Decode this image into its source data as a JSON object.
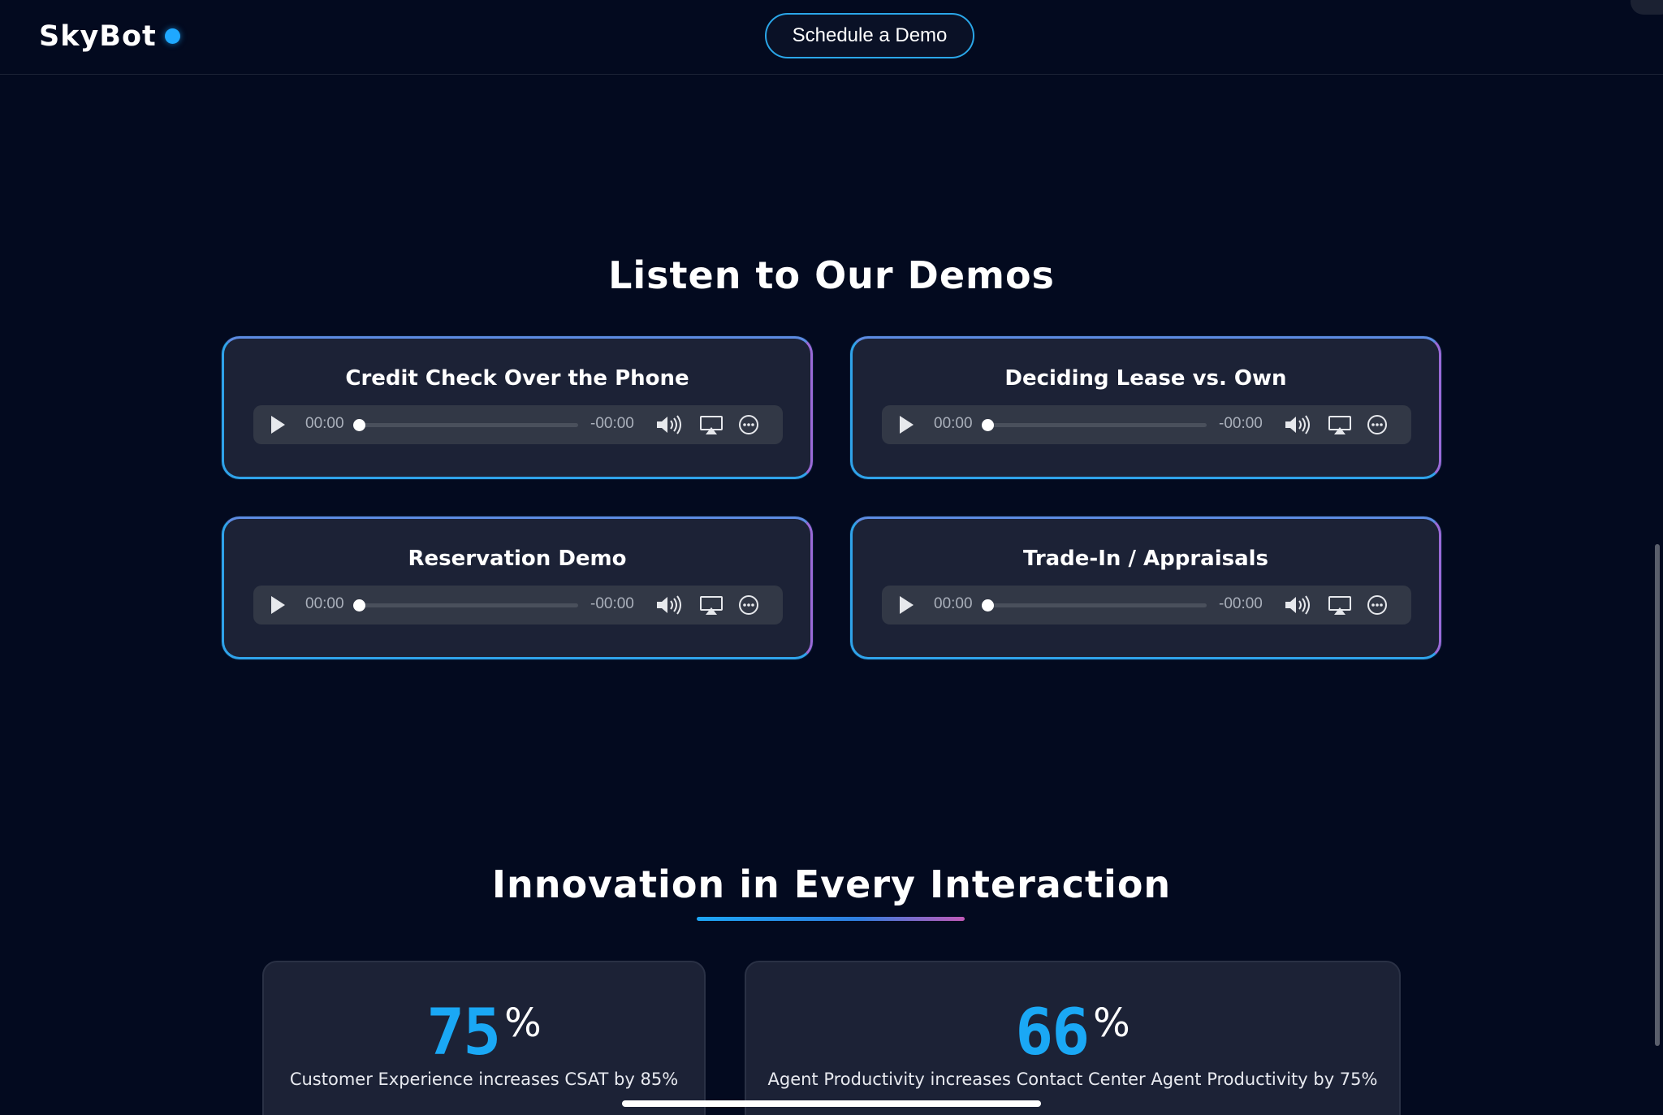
{
  "header": {
    "logo_text": "SkyBot",
    "cta_label": "Schedule a Demo"
  },
  "demos": {
    "title": "Listen to Our Demos",
    "cards": [
      {
        "title": "Credit Check Over the Phone",
        "current_time": "00:00",
        "remaining_time": "-00:00",
        "progress": 0
      },
      {
        "title": "Deciding Lease vs. Own",
        "current_time": "00:00",
        "remaining_time": "-00:00",
        "progress": 0
      },
      {
        "title": "Reservation Demo",
        "current_time": "00:00",
        "remaining_time": "-00:00",
        "progress": 0
      },
      {
        "title": "Trade-In / Appraisals",
        "current_time": "00:00",
        "remaining_time": "-00:00",
        "progress": 0
      }
    ]
  },
  "innovation": {
    "title": "Innovation in Every Interaction",
    "stats": [
      {
        "value": "75",
        "unit": "%",
        "description": "Customer Experience increases CSAT by 85%"
      },
      {
        "value": "66",
        "unit": "%",
        "description": "Agent Productivity increases Contact Center Agent Productivity by 75%"
      }
    ]
  },
  "colors": {
    "background": "#030a1f",
    "accent": "#1aa8f5",
    "card": "#1c2236",
    "gradient_end": "#c25ab8"
  },
  "icons": [
    "play-icon",
    "volume-icon",
    "airplay-icon",
    "more-options-icon"
  ]
}
